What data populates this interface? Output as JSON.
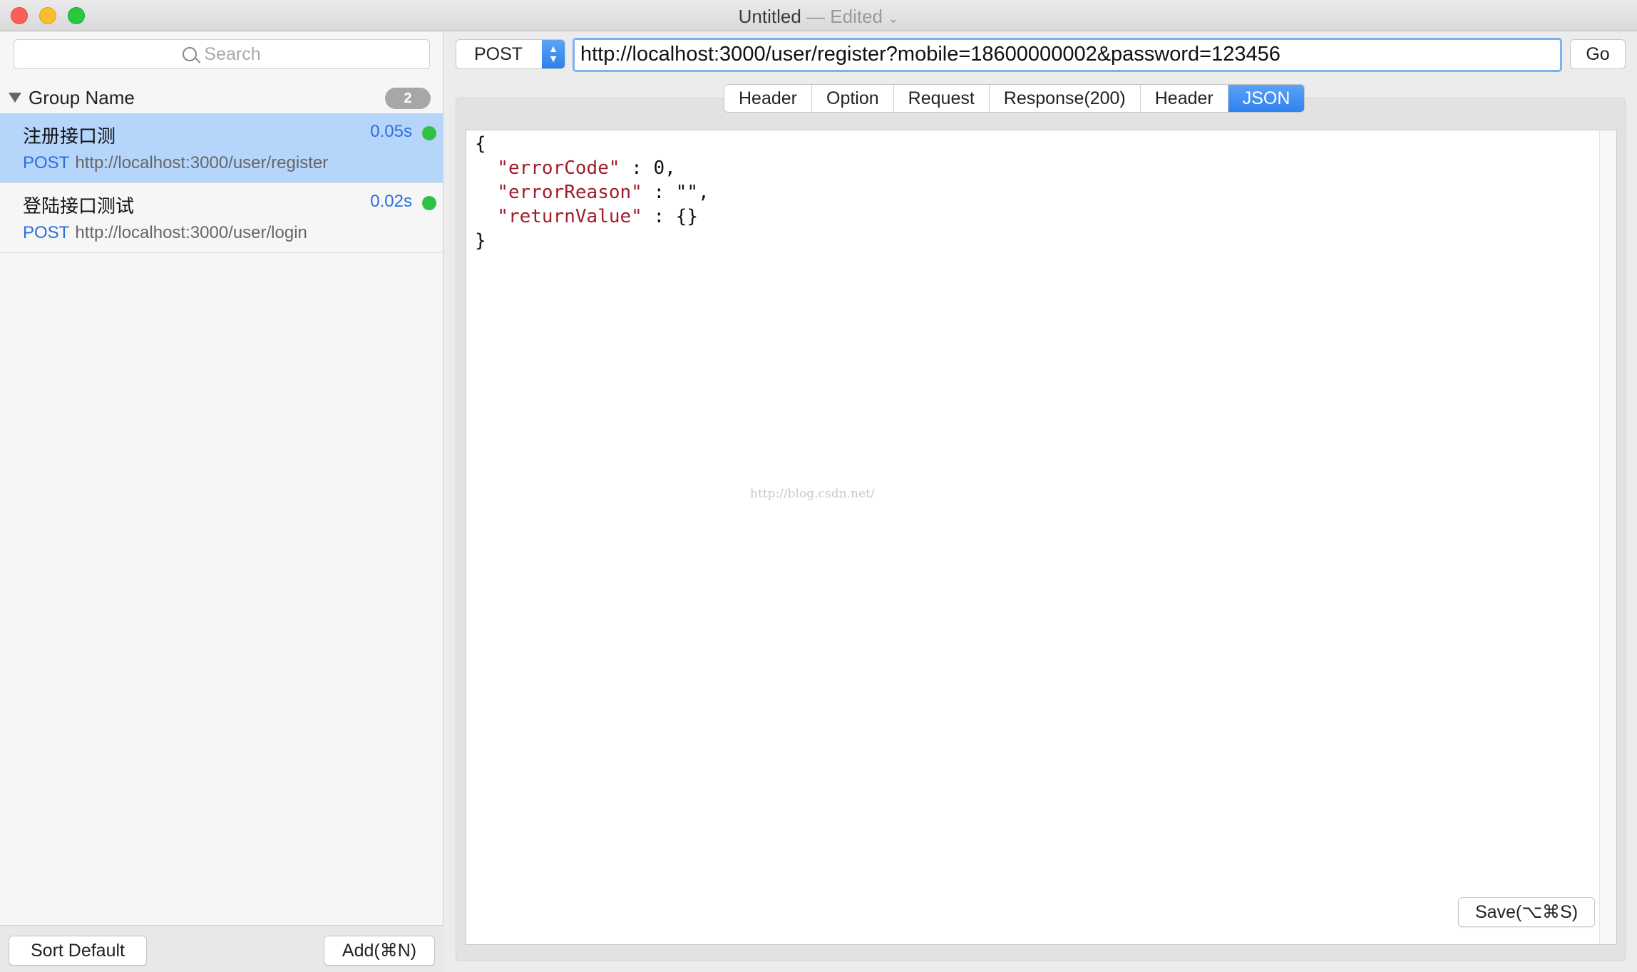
{
  "window": {
    "title": "Untitled",
    "status": "— Edited",
    "status_chevron": "⌄"
  },
  "sidebar": {
    "search_placeholder": "Search",
    "group": {
      "name": "Group Name",
      "count": "2"
    },
    "items": [
      {
        "name": "注册接口测",
        "time": "0.05s",
        "method": "POST",
        "url": "http://localhost:3000/user/register",
        "status_color": "#2fc144",
        "selected": true
      },
      {
        "name": "登陆接口测试",
        "time": "0.02s",
        "method": "POST",
        "url": "http://localhost:3000/user/login",
        "status_color": "#2fc144",
        "selected": false
      }
    ],
    "footer": {
      "sort_label": "Sort Default",
      "add_label": "Add(⌘N)"
    }
  },
  "request": {
    "method": "POST",
    "url": "http://localhost:3000/user/register?mobile=18600000002&password=123456",
    "go_label": "Go"
  },
  "tabs": [
    "Header",
    "Option",
    "Request",
    "Response(200)",
    "Header",
    "JSON"
  ],
  "active_tab": "JSON",
  "response_json": {
    "open": "{",
    "line1_key": "\"errorCode\"",
    "line1_val": " : 0,",
    "line2_key": "\"errorReason\"",
    "line2_val": " : \"\",",
    "line3_key": "\"returnValue\"",
    "line3_val": " : {}",
    "close": "}"
  },
  "watermark": "http://blog.csdn.net/",
  "save_label": "Save(⌥⌘S)",
  "colors": {
    "accent": "#2f82ef",
    "selection": "#b5d5fb",
    "link": "#2d6fdc",
    "json_key": "#a11c2a",
    "status_ok": "#2fc144"
  }
}
